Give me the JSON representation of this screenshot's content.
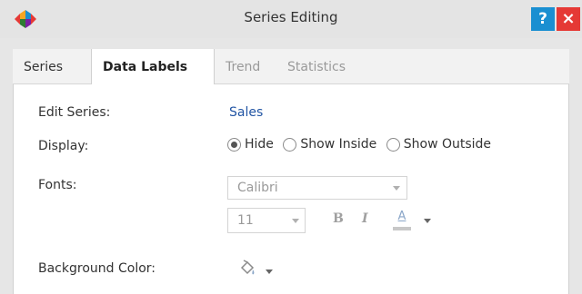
{
  "window": {
    "title": "Series Editing",
    "help_label": "?",
    "close_label": "×"
  },
  "tabs": [
    {
      "label": "Series",
      "state": "normal"
    },
    {
      "label": "Data Labels",
      "state": "active"
    },
    {
      "label": "Trend",
      "state": "disabled"
    },
    {
      "label": "Statistics",
      "state": "disabled"
    }
  ],
  "form": {
    "edit_series_label": "Edit Series:",
    "edit_series_value": "Sales",
    "display_label": "Display:",
    "display_options": [
      {
        "label": "Hide",
        "checked": true
      },
      {
        "label": "Show Inside",
        "checked": false
      },
      {
        "label": "Show Outside",
        "checked": false
      }
    ],
    "fonts_label": "Fonts:",
    "font_family": "Calibri",
    "font_size": "11",
    "bold_label": "B",
    "italic_label": "I",
    "font_color_label": "A",
    "background_color_label": "Background Color:"
  },
  "colors": {
    "help_button": "#1a8fd1",
    "close_button": "#e53935",
    "link": "#2255a4"
  },
  "icons": {
    "logo": "app-logo-icon",
    "background_color": "paint-bucket-icon",
    "dropdown": "chevron-down-icon"
  }
}
